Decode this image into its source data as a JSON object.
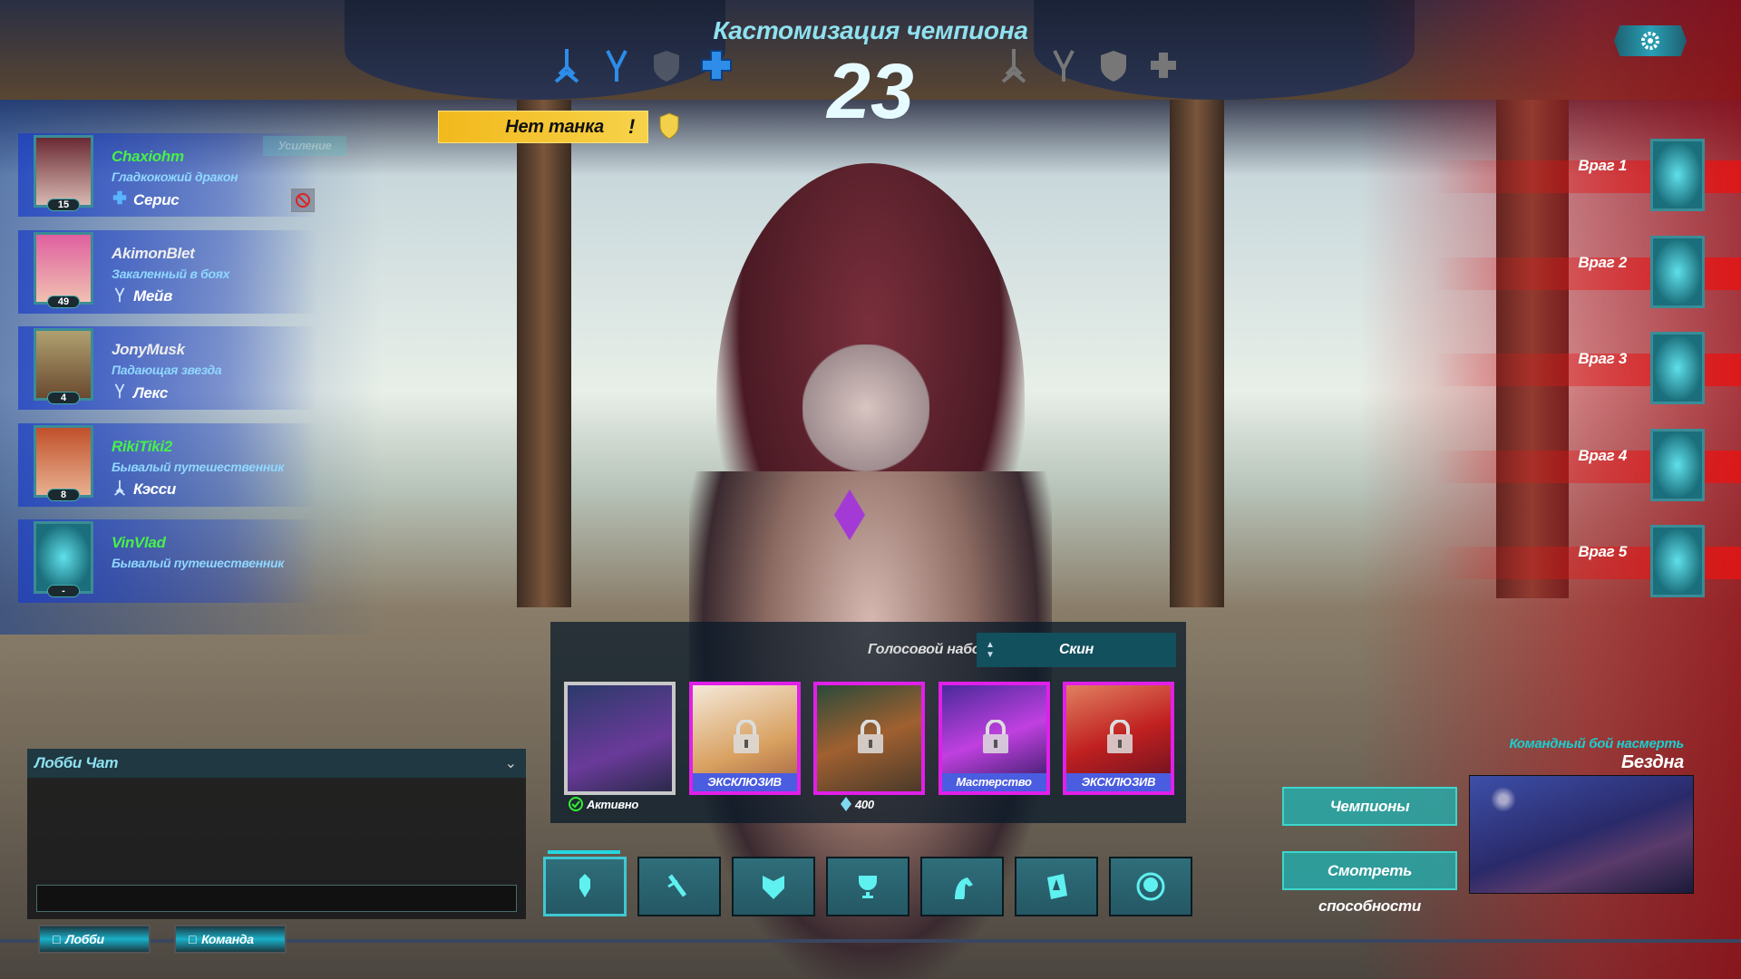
{
  "header": {
    "title": "Кастомизация чемпиона",
    "timer": "23",
    "warning": "Нет танка",
    "warning_mark": "!"
  },
  "allies": [
    {
      "name": "Chaxiohm",
      "title": "Гладкокожий дракон",
      "champion": "Серис",
      "level": "15",
      "role": "support",
      "name_color": "green"
    },
    {
      "name": "AkimonBlet",
      "title": "Закаленный в боях",
      "champion": "Мейв",
      "level": "49",
      "role": "flank",
      "name_color": "white"
    },
    {
      "name": "JonyMusk",
      "title": "Падающая звезда",
      "champion": "Лекс",
      "level": "4",
      "role": "flank",
      "name_color": "white"
    },
    {
      "name": "RikiTiki2",
      "title": "Бывалый путешественник",
      "champion": "Кэсси",
      "level": "8",
      "role": "damage",
      "name_color": "green"
    },
    {
      "name": "VinVlad",
      "title": "Бывалый путешественник",
      "champion": "",
      "level": "-",
      "role": "",
      "name_color": "green"
    }
  ],
  "boost_label": "Усиление",
  "enemies": [
    "Враг 1",
    "Враг 2",
    "Враг 3",
    "Враг 4",
    "Враг 5"
  ],
  "skins": {
    "voice_label": "Голосовой набор:",
    "voice_value": "Скин",
    "cards": [
      {
        "tag": "",
        "locked": false,
        "active": true
      },
      {
        "tag": "ЭКСКЛЮЗИВ",
        "locked": true
      },
      {
        "tag": "",
        "locked": true
      },
      {
        "tag": "Мастерство",
        "locked": true
      },
      {
        "tag": "ЭКСКЛЮЗИВ",
        "locked": true
      }
    ],
    "active_label": "Активно",
    "price": "400"
  },
  "tabs": [
    "skins",
    "weapons",
    "voice",
    "emotes",
    "mounts",
    "sprays",
    "death-effects"
  ],
  "chat": {
    "title": "Лобби Чат",
    "input_placeholder": "",
    "tabs": [
      "Лобби",
      "Команда"
    ]
  },
  "match": {
    "mode": "Командный бой насмерть",
    "map": "Бездна"
  },
  "buttons": {
    "champions": "Чемпионы",
    "abilities": "Смотреть способности"
  },
  "colors": {
    "accent": "#3ec8d2",
    "ally": "#1a3cc8",
    "enemy": "#e01414",
    "rare": "#e020e8",
    "warning": "#f2b91c"
  }
}
